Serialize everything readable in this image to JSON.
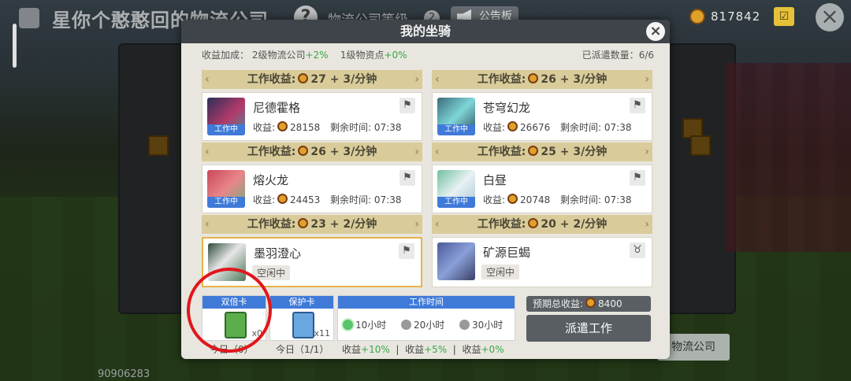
{
  "topbar": {
    "title": "星你个憨憨回的物流公司",
    "help": "?",
    "link": "物流公司等级",
    "badge": "2",
    "notice": "公告板",
    "coins": "817842",
    "cart": "☑",
    "close": "×"
  },
  "background": {
    "player_id": "90906283",
    "company_button": "物流公司"
  },
  "modal": {
    "title": "我的坐骑",
    "close": "×",
    "info": {
      "income_label": "收益加成：",
      "company": "2级物流公司",
      "company_bonus": "+2%",
      "resource": "1级物资点",
      "resource_bonus": "+0%",
      "dispatched_label": "已派遣数量：",
      "dispatched": "6/6"
    },
    "strips": [
      {
        "prefix": "工作收益:",
        "value": "27 + 3/分钟"
      },
      {
        "prefix": "工作收益:",
        "value": "26 + 3/分钟"
      },
      {
        "prefix": "工作收益:",
        "value": "26 + 3/分钟"
      },
      {
        "prefix": "工作收益:",
        "value": "25 + 3/分钟"
      },
      {
        "prefix": "工作收益:",
        "value": "23 + 2/分钟"
      },
      {
        "prefix": "工作收益:",
        "value": "20 + 2/分钟"
      }
    ],
    "mounts": [
      {
        "name": "尼德霍格",
        "status": "工作中",
        "income_label": "收益:",
        "income": "28158",
        "time_label": "剩余时间:",
        "time": "07:38"
      },
      {
        "name": "苍穹幻龙",
        "status": "工作中",
        "income_label": "收益:",
        "income": "26676",
        "time_label": "剩余时间:",
        "time": "07:38"
      },
      {
        "name": "熔火龙",
        "status": "工作中",
        "income_label": "收益:",
        "income": "24453",
        "time_label": "剩余时间:",
        "time": "07:38"
      },
      {
        "name": "白昼",
        "status": "工作中",
        "income_label": "收益:",
        "income": "20748",
        "time_label": "剩余时间:",
        "time": "07:38"
      },
      {
        "name": "墨羽澄心",
        "status": "空闲中"
      },
      {
        "name": "矿源巨蝎",
        "status": "空闲中"
      }
    ],
    "items": [
      {
        "title": "双倍卡",
        "count": "x0",
        "note": "今日（0）"
      },
      {
        "title": "保护卡",
        "count": "x11",
        "note": "今日（1/1）"
      }
    ],
    "worktime": {
      "title": "工作时间",
      "options": [
        "10小时",
        "20小时",
        "30小时"
      ],
      "bonus_label": "收益",
      "bonuses": [
        "+10%",
        "+5%",
        "+0%"
      ]
    },
    "expected_label": "预期总收益:",
    "expected": "8400",
    "dispatch_button": "派遣工作"
  },
  "colors": {
    "accent_blue": "#3f7ad8",
    "gold_strip": "#d9cc9a",
    "green": "#3aa74a",
    "annotation_red": "#e0171c"
  }
}
